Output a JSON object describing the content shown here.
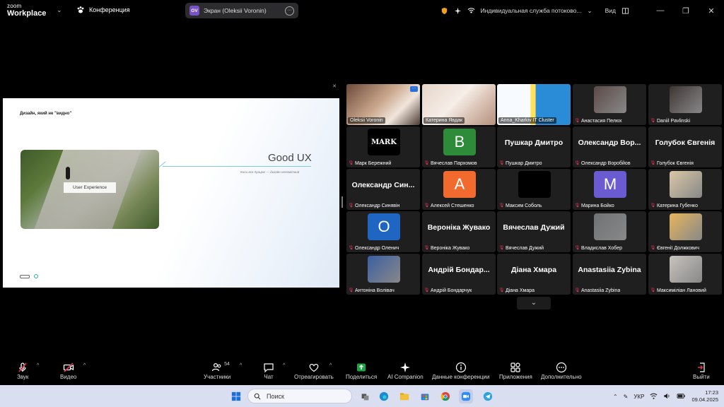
{
  "app": {
    "logo_line1": "zoom",
    "logo_line2": "Workplace",
    "meeting_label": "Конференция",
    "share_title": "Экран (Oleksii Voronin)",
    "share_avatar": "OV",
    "topbar_info": "Индивидуальная служба потоково...",
    "view_label": "Вид"
  },
  "slide": {
    "title": "Дизайн, який не \"видно\"",
    "photo_tag": "User Experience",
    "heading": "Good UX",
    "subheading": "Коли все працює — дизайн непомітний"
  },
  "participants": [
    {
      "name": "Oleksii Voronin",
      "type": "video",
      "active": true
    },
    {
      "name": "Катерина Явдак",
      "type": "video"
    },
    {
      "name": "Anna_Kharkiv IT Cluster",
      "type": "video"
    },
    {
      "name": "Анастасия Пелюх",
      "type": "photo"
    },
    {
      "name": "Daniil Pavlinski",
      "type": "photo"
    },
    {
      "name": "Марк Бережний",
      "type": "image",
      "image_text": "MARK"
    },
    {
      "name": "Вячеслав Пархомов",
      "type": "letter",
      "letter": "В",
      "color": "#2e8b3a"
    },
    {
      "name": "Пушкар Дмитро",
      "type": "text",
      "display": "Пушкар Дмитро"
    },
    {
      "name": "Олександр Воробйов",
      "type": "text",
      "display": "Олександр Вор..."
    },
    {
      "name": "Голубок Євгенія",
      "type": "text",
      "display": "Голубок Євгенія"
    },
    {
      "name": "Олександр Синявін",
      "type": "text",
      "display": "Олександр Син..."
    },
    {
      "name": "Алексей Стешенко",
      "type": "letter",
      "letter": "А",
      "color": "#f26a2e"
    },
    {
      "name": "Максим Соболь",
      "type": "blank"
    },
    {
      "name": "Марина Бойко",
      "type": "letter",
      "letter": "М",
      "color": "#6a5bd1"
    },
    {
      "name": "Катерина Губенко",
      "type": "photo"
    },
    {
      "name": "Олександр Оленич",
      "type": "letter",
      "letter": "О",
      "color": "#1f66c2"
    },
    {
      "name": "Вероніка Жувако",
      "type": "text",
      "display": "Вероніка Жувако"
    },
    {
      "name": "Вячеслав Дужий",
      "type": "text",
      "display": "Вячеслав Дужий"
    },
    {
      "name": "Владислав Хобер",
      "type": "photo"
    },
    {
      "name": "Євгенії Должкович",
      "type": "photo"
    },
    {
      "name": "Антоніна Волівач",
      "type": "photo"
    },
    {
      "name": "Андрій Бондарчук",
      "type": "text",
      "display": "Андрій Бондар..."
    },
    {
      "name": "Діана Хмара",
      "type": "text",
      "display": "Діана Хмара"
    },
    {
      "name": "Anastasiia Zybina",
      "type": "text",
      "display": "Anastasiia Zybina"
    },
    {
      "name": "Максиміліан Лановий",
      "type": "photo"
    }
  ],
  "toolbar": {
    "audio": "Звук",
    "video": "Видео",
    "participants": "Участники",
    "participants_count": "54",
    "chat": "Чат",
    "react": "Отреагировать",
    "share": "Поделиться",
    "ai": "AI Companion",
    "info": "Данные конференции",
    "apps": "Приложения",
    "more": "Дополнительно",
    "leave": "Выйти"
  },
  "taskbar": {
    "search_placeholder": "Поиск",
    "lang": "УКР",
    "time": "17:23",
    "date": "09.04.2025"
  },
  "colors": {
    "accent_green": "#1ea446",
    "mic_muted": "#e0364f",
    "zoom_blue": "#2b6fdc"
  }
}
